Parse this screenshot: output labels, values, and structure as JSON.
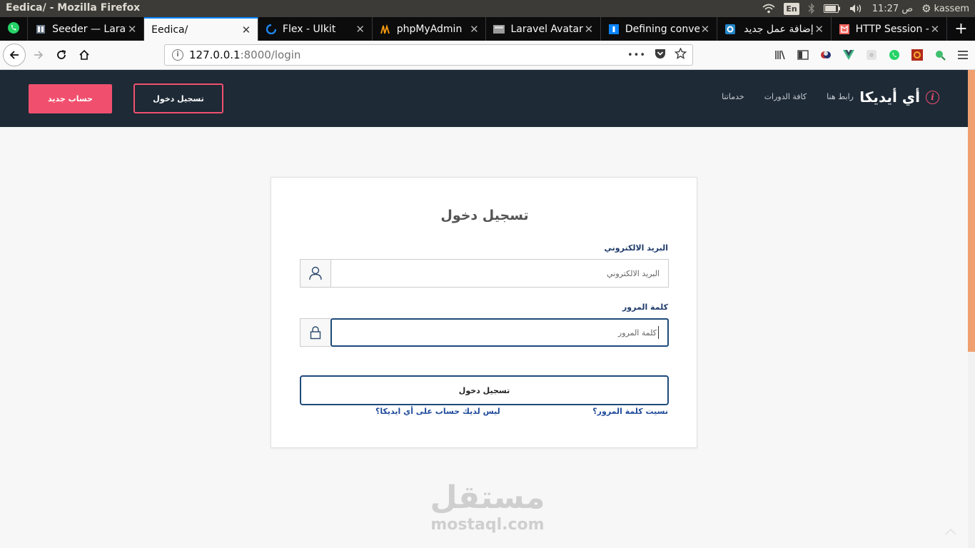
{
  "os": {
    "window_title": "Eedica/ - Mozilla Firefox",
    "lang": "En",
    "time": "11:27",
    "ampm": "ص",
    "user": "kassem"
  },
  "tabs": [
    {
      "title": "Seeder — Laravel",
      "icon": "document-icon",
      "active": false
    },
    {
      "title": "Eedica/",
      "icon": "",
      "active": true
    },
    {
      "title": "Flex - UIkit",
      "icon": "uikit-icon",
      "active": false
    },
    {
      "title": "phpMyAdmin",
      "icon": "phpmyadmin-icon",
      "active": false
    },
    {
      "title": "Laravel Avatar",
      "icon": "image-icon",
      "active": false
    },
    {
      "title": "Defining conve",
      "icon": "docs-icon",
      "active": false
    },
    {
      "title": "إضافة عمل جديد",
      "icon": "blue-square-icon",
      "active": false
    },
    {
      "title": "HTTP Session -",
      "icon": "laravel-icon",
      "active": false
    }
  ],
  "address": {
    "host": "127.0.0.1",
    "path": ":8000/login",
    "more": "•••"
  },
  "header": {
    "register_label": "حساب جديد",
    "login_label": "تسجيل دخول",
    "nav": [
      "رابط هنا",
      "كافة الدورات",
      "خدماتنا"
    ],
    "brand": "أي أيديكا",
    "brand_icon": "i"
  },
  "login": {
    "title": "تسجيل دخول",
    "email_label": "البريد الالكتروني",
    "email_placeholder": "البريد الالكتروني",
    "password_label": "كلمة المرور",
    "password_placeholder": "كلمة المرور",
    "submit_label": "تسجيل دخول",
    "forgot_link": "نسيت كلمة المرور؟",
    "no_account_link": "ليس لديك حساب على أي ايديكا؟"
  },
  "watermark": {
    "arabic": "مستقل",
    "latin": "mostaql.com"
  },
  "colors": {
    "header_bg": "#1e2a36",
    "accent": "#f0506e",
    "primary": "#1e4a7a"
  }
}
